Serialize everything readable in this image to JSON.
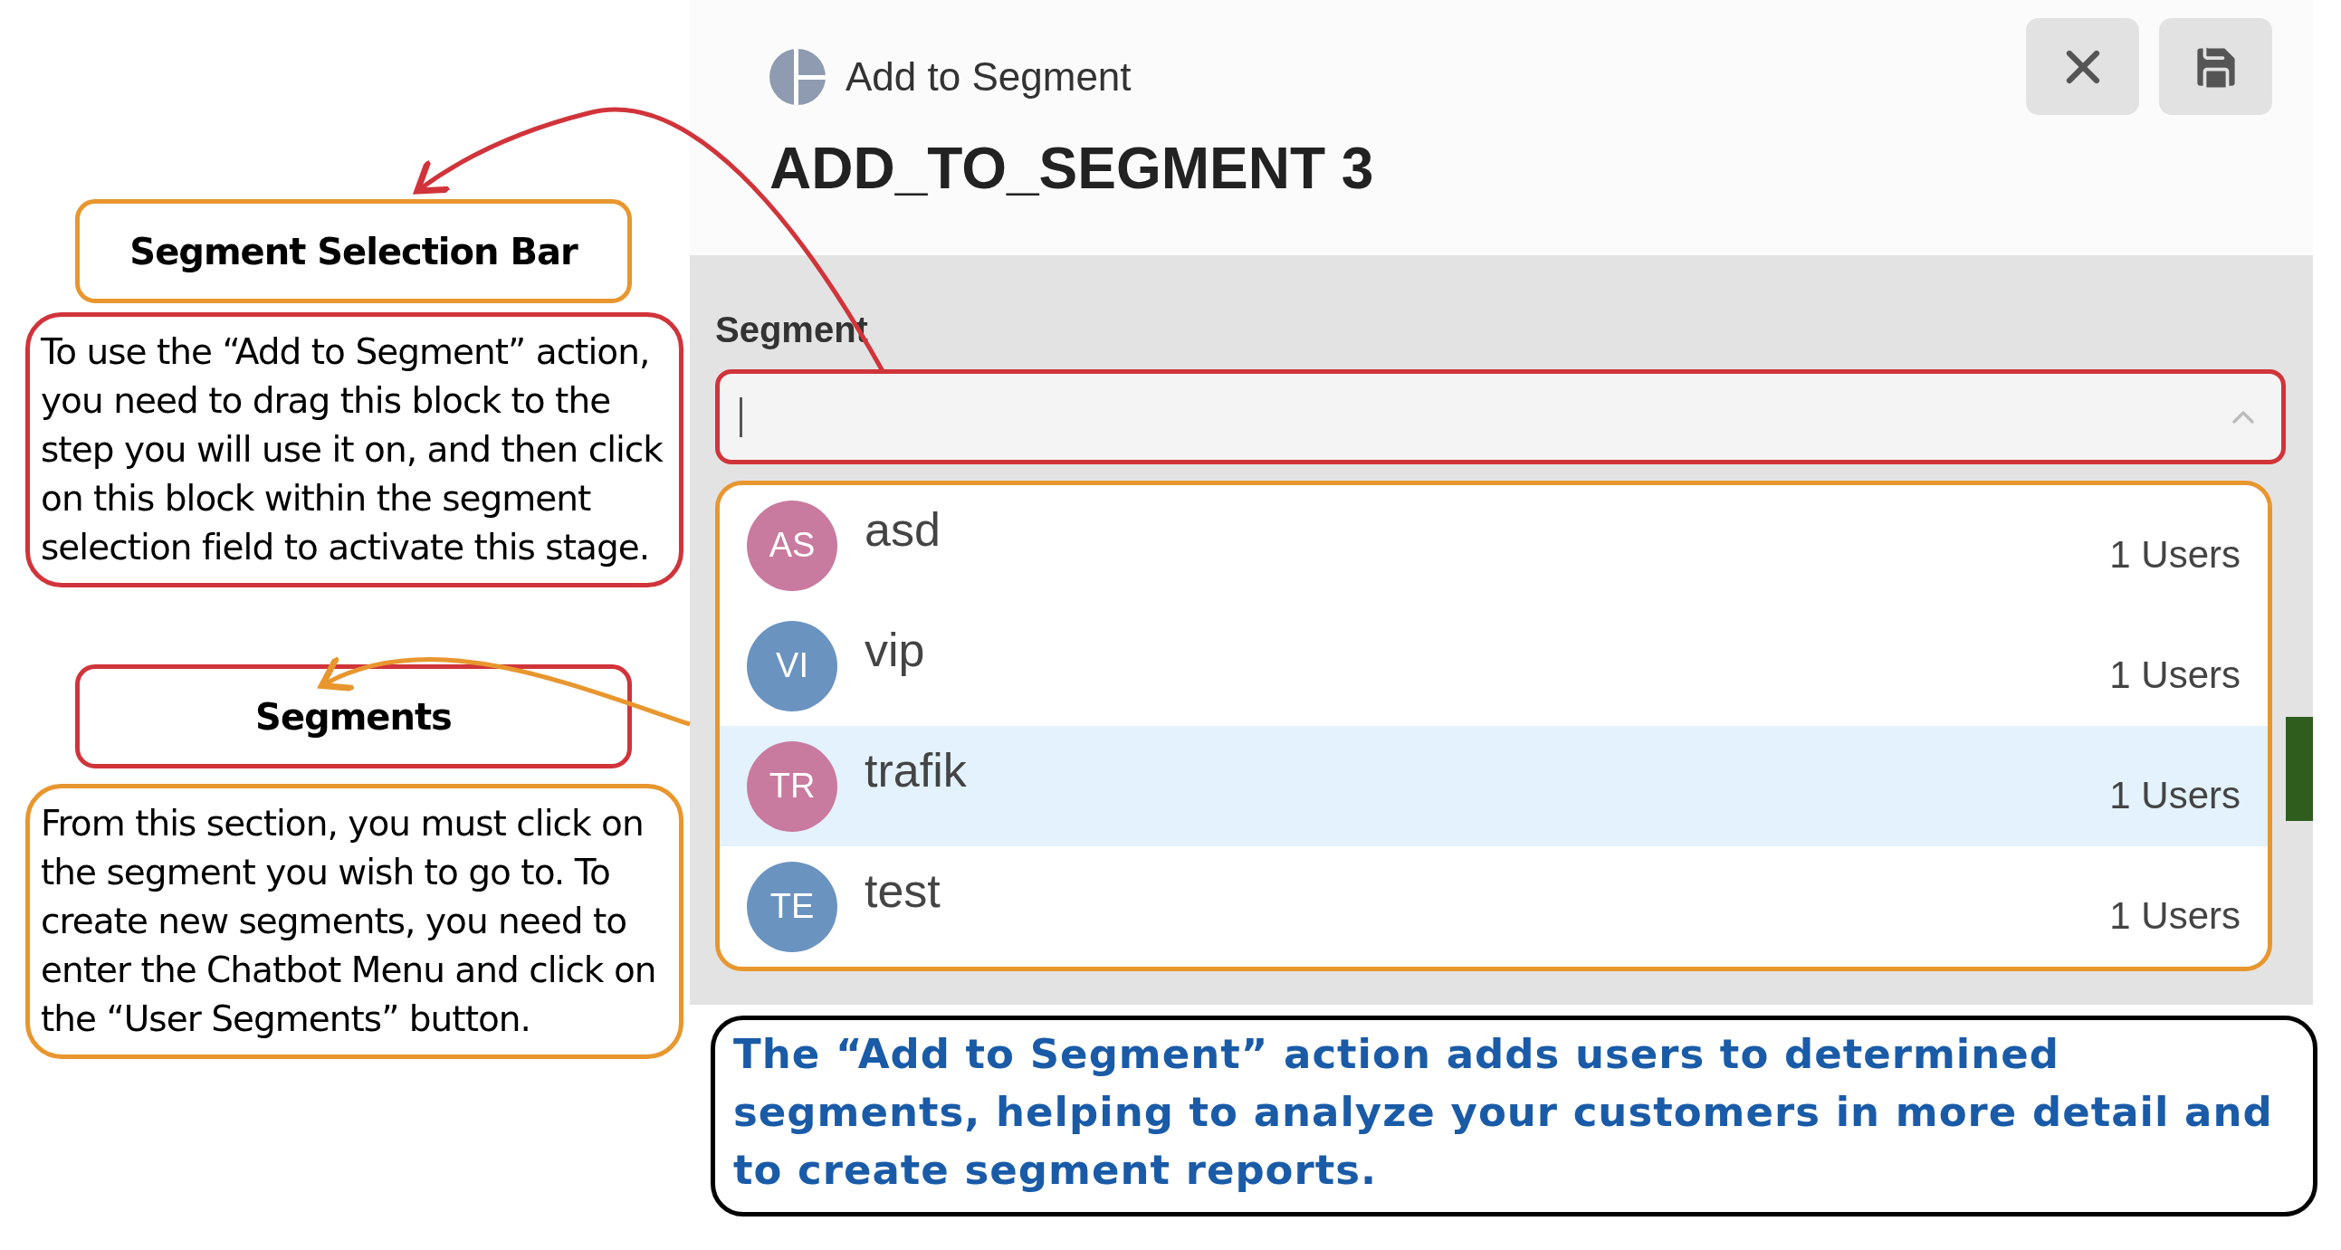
{
  "dialog": {
    "subtitle": "Add to Segment",
    "title": "ADD_TO_SEGMENT 3",
    "buttons": [
      {
        "kind": "close"
      },
      {
        "kind": "save"
      }
    ]
  },
  "segment_field": {
    "label": "Segment",
    "expanded": true
  },
  "segments": [
    {
      "initials": "AS",
      "name": "asd",
      "count": "1 Users",
      "color": "#c97a9f",
      "selected": false
    },
    {
      "initials": "VI",
      "name": "vip",
      "count": "1 Users",
      "color": "#6b93c0",
      "selected": false
    },
    {
      "initials": "TR",
      "name": "trafik",
      "count": "1 Users",
      "color": "#c97a9f",
      "selected": true
    },
    {
      "initials": "TE",
      "name": "test",
      "count": "1 Users",
      "color": "#6b93c0",
      "selected": false
    }
  ],
  "annotations": [
    {
      "kind": "heading",
      "text": "Segment Selection Bar",
      "color": "#e8962e"
    },
    {
      "kind": "body",
      "text": "To use the “Add to Segment” action, you need to drag this block to the step you will use it on, and then click on this block within the segment selection field to activate this stage.",
      "color": "#d0343a"
    },
    {
      "kind": "heading",
      "text": "Segments",
      "color": "#d0343a"
    },
    {
      "kind": "body",
      "text": "From this section, you must click on the segment you wish to go to. To create new segments, you need to enter the Chatbot Menu and click on the “User Segments” button.",
      "color": "#e8962e"
    }
  ],
  "note": {
    "text": "The “Add to Segment” action adds users to determined segments, helping to analyze your customers in more detail and to create segment reports."
  }
}
